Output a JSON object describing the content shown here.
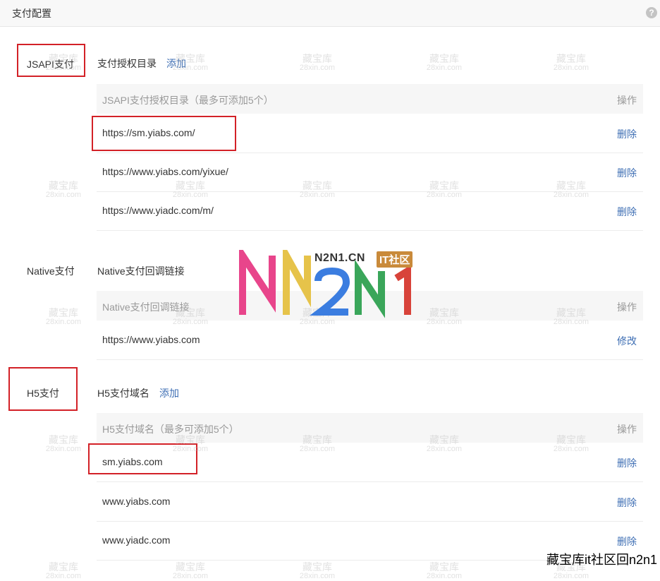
{
  "header": {
    "title": "支付配置",
    "help_icon": "?"
  },
  "jsapi": {
    "label": "JSAPI支付",
    "sub_title": "支付授权目录",
    "add_label": "添加",
    "table": {
      "col_header": "JSAPI支付授权目录（最多可添加5个）",
      "action_header": "操作",
      "rows": [
        {
          "url": "https://sm.yiabs.com/",
          "action": "删除"
        },
        {
          "url": "https://www.yiabs.com/yixue/",
          "action": "删除"
        },
        {
          "url": "https://www.yiadc.com/m/",
          "action": "删除"
        }
      ]
    }
  },
  "native": {
    "label": "Native支付",
    "sub_title": "Native支付回调链接",
    "table": {
      "col_header": "Native支付回调链接",
      "action_header": "操作",
      "rows": [
        {
          "url": "https://www.yiabs.com",
          "action": "修改"
        }
      ]
    }
  },
  "h5": {
    "label": "H5支付",
    "sub_title": "H5支付域名",
    "add_label": "添加",
    "table": {
      "col_header": "H5支付域名（最多可添加5个）",
      "action_header": "操作",
      "rows": [
        {
          "url": "sm.yiabs.com",
          "action": "删除"
        },
        {
          "url": "www.yiabs.com",
          "action": "删除"
        },
        {
          "url": "www.yiadc.com",
          "action": "删除"
        }
      ]
    }
  },
  "watermark": {
    "line1": "藏宝库",
    "line2": "28xin.com"
  },
  "logo": {
    "letters": "N2N1",
    "subtitle": "N2N1.CN",
    "tag": "IT社区"
  },
  "footer_mark": "藏宝库it社区回n2n1",
  "colors": {
    "link": "#3f6fb4",
    "highlight_border": "#d32127",
    "header_bg": "#f8f8f8",
    "table_head_bg": "#f6f6f6"
  }
}
